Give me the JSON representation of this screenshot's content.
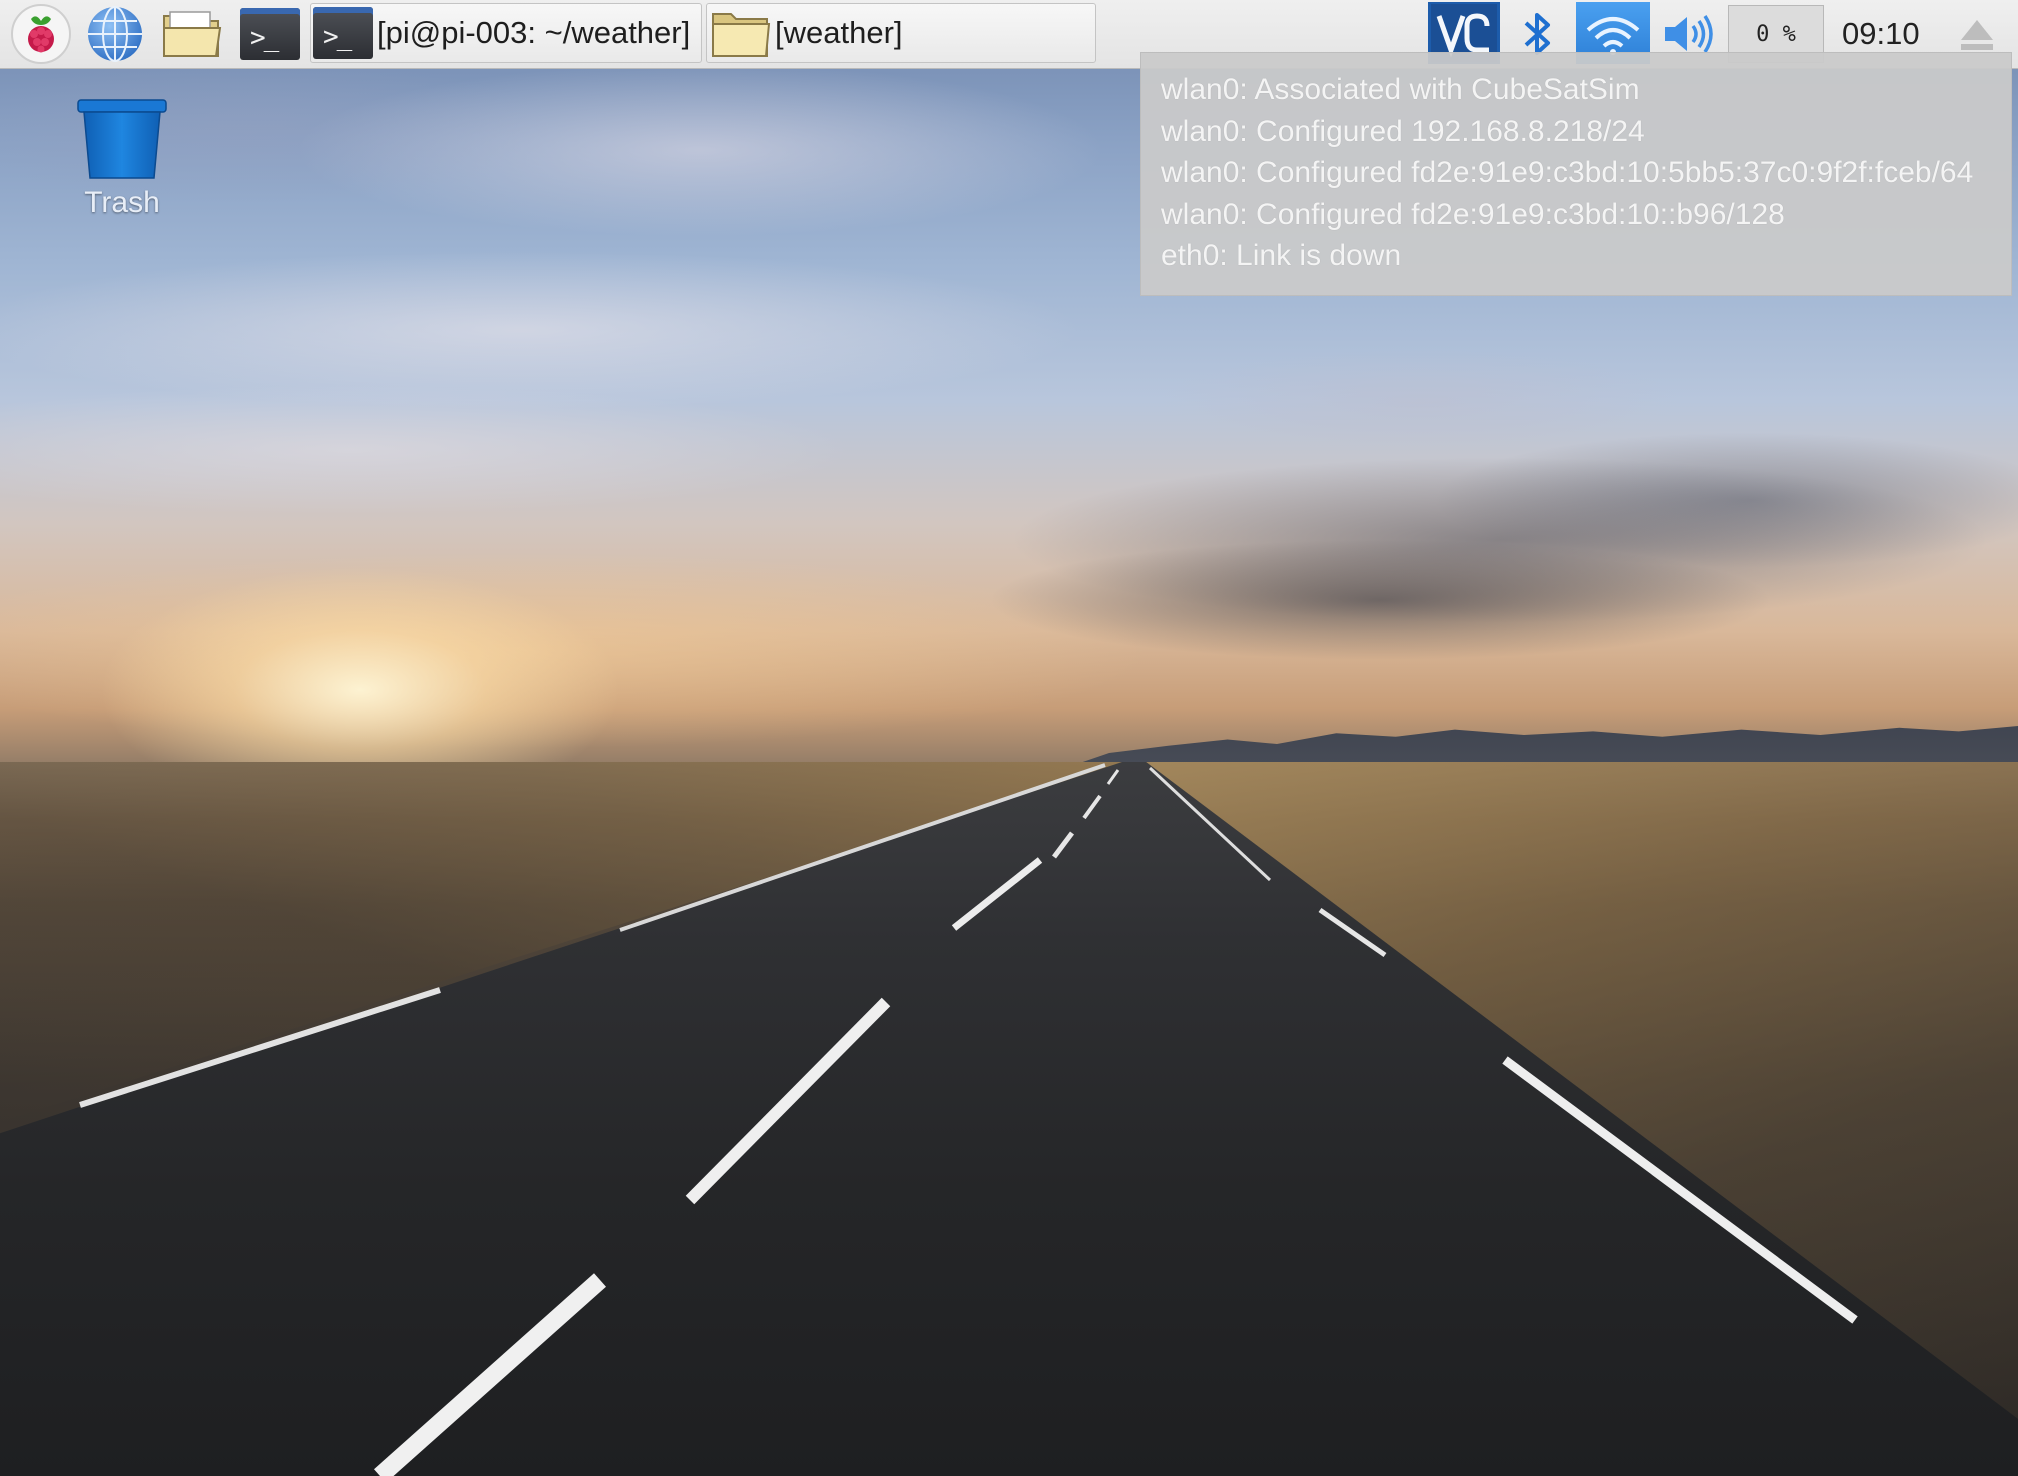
{
  "taskbar": {
    "menu_icon": "raspberry-icon",
    "browser_icon": "globe-icon",
    "file_manager_icon": "folder-icon",
    "terminal_icon": "terminal-icon",
    "terminal_glyph": ">_",
    "tasks": [
      {
        "label": "[pi@pi-003: ~/weather]",
        "icon": "terminal-icon"
      },
      {
        "label": "[weather]",
        "icon": "folder-icon"
      }
    ],
    "tray": {
      "vnc_icon": "vnc-icon",
      "bluetooth_icon": "bluetooth-icon",
      "wifi_icon": "wifi-icon",
      "volume_icon": "volume-icon",
      "cpu_usage": "0 %",
      "clock": "09:10",
      "eject_icon": "eject-icon"
    }
  },
  "notification": {
    "lines": [
      "wlan0: Associated with CubeSatSim",
      "wlan0: Configured 192.168.8.218/24",
      "wlan0: Configured fd2e:91e9:c3bd:10:5bb5:37c0:9f2f:fceb/64",
      "wlan0: Configured fd2e:91e9:c3bd:10::b96/128",
      "eth0: Link is down"
    ]
  },
  "desktop": {
    "icons": [
      {
        "label": "Trash",
        "icon": "trash-icon"
      }
    ]
  },
  "colors": {
    "panel": "#e8e8e8",
    "tray_accent": "#1e6fd0",
    "trash_blue": "#1677d2"
  }
}
